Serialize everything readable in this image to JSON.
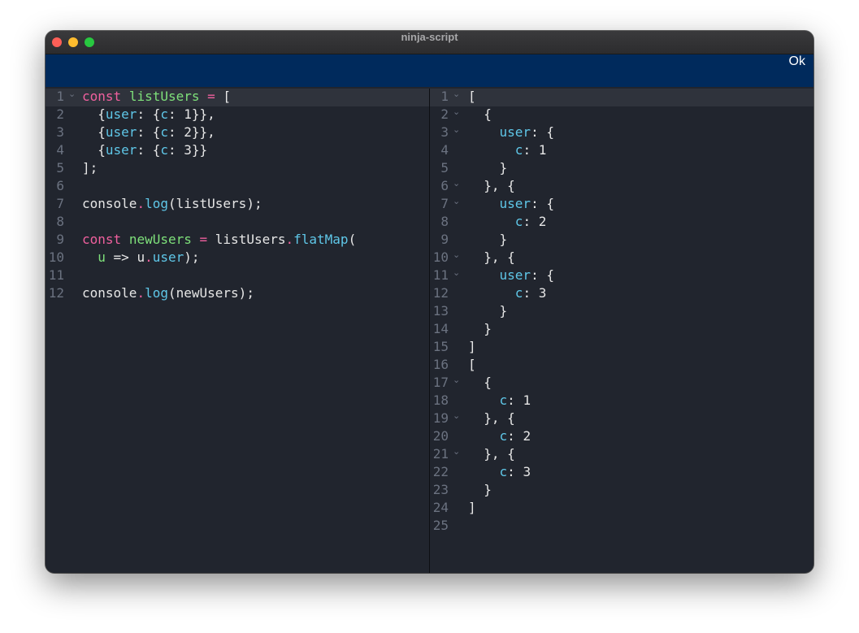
{
  "window": {
    "title": "ninja-script"
  },
  "toolbar": {
    "ok_label": "Ok"
  },
  "editor": {
    "lines": [
      {
        "n": "1",
        "fold": true,
        "tokens": [
          {
            "t": "const",
            "c": "kw"
          },
          {
            "t": " ",
            "c": "txt"
          },
          {
            "t": "listUsers",
            "c": "def"
          },
          {
            "t": " ",
            "c": "txt"
          },
          {
            "t": "=",
            "c": "kw"
          },
          {
            "t": " [",
            "c": "txt"
          }
        ]
      },
      {
        "n": "2",
        "fold": false,
        "tokens": [
          {
            "t": "  {",
            "c": "txt"
          },
          {
            "t": "user",
            "c": "prop"
          },
          {
            "t": ": {",
            "c": "txt"
          },
          {
            "t": "c",
            "c": "prop"
          },
          {
            "t": ": 1}},",
            "c": "txt"
          }
        ]
      },
      {
        "n": "3",
        "fold": false,
        "tokens": [
          {
            "t": "  {",
            "c": "txt"
          },
          {
            "t": "user",
            "c": "prop"
          },
          {
            "t": ": {",
            "c": "txt"
          },
          {
            "t": "c",
            "c": "prop"
          },
          {
            "t": ": 2}},",
            "c": "txt"
          }
        ]
      },
      {
        "n": "4",
        "fold": false,
        "tokens": [
          {
            "t": "  {",
            "c": "txt"
          },
          {
            "t": "user",
            "c": "prop"
          },
          {
            "t": ": {",
            "c": "txt"
          },
          {
            "t": "c",
            "c": "prop"
          },
          {
            "t": ": 3}}",
            "c": "txt"
          }
        ]
      },
      {
        "n": "5",
        "fold": false,
        "tokens": [
          {
            "t": "];",
            "c": "txt"
          }
        ]
      },
      {
        "n": "6",
        "fold": false,
        "tokens": []
      },
      {
        "n": "7",
        "fold": false,
        "tokens": [
          {
            "t": "console",
            "c": "txt"
          },
          {
            "t": ".",
            "c": "pun"
          },
          {
            "t": "log",
            "c": "fn"
          },
          {
            "t": "(listUsers);",
            "c": "txt"
          }
        ]
      },
      {
        "n": "8",
        "fold": false,
        "tokens": []
      },
      {
        "n": "9",
        "fold": false,
        "tokens": [
          {
            "t": "const",
            "c": "kw"
          },
          {
            "t": " ",
            "c": "txt"
          },
          {
            "t": "newUsers",
            "c": "def"
          },
          {
            "t": " ",
            "c": "txt"
          },
          {
            "t": "=",
            "c": "kw"
          },
          {
            "t": " listUsers",
            "c": "txt"
          },
          {
            "t": ".",
            "c": "pun"
          },
          {
            "t": "flatMap",
            "c": "fn"
          },
          {
            "t": "(",
            "c": "txt"
          }
        ]
      },
      {
        "n": "10",
        "fold": false,
        "tokens": [
          {
            "t": "  ",
            "c": "txt"
          },
          {
            "t": "u",
            "c": "def"
          },
          {
            "t": " => u",
            "c": "txt"
          },
          {
            "t": ".",
            "c": "pun"
          },
          {
            "t": "user",
            "c": "prop"
          },
          {
            "t": ");",
            "c": "txt"
          }
        ]
      },
      {
        "n": "11",
        "fold": false,
        "tokens": []
      },
      {
        "n": "12",
        "fold": false,
        "tokens": [
          {
            "t": "console",
            "c": "txt"
          },
          {
            "t": ".",
            "c": "pun"
          },
          {
            "t": "log",
            "c": "fn"
          },
          {
            "t": "(newUsers);",
            "c": "txt"
          }
        ]
      }
    ]
  },
  "output": {
    "lines": [
      {
        "n": "1",
        "fold": true,
        "tokens": [
          {
            "t": "[",
            "c": "txt"
          }
        ]
      },
      {
        "n": "2",
        "fold": true,
        "tokens": [
          {
            "t": "  {",
            "c": "txt"
          }
        ]
      },
      {
        "n": "3",
        "fold": true,
        "tokens": [
          {
            "t": "    ",
            "c": "txt"
          },
          {
            "t": "user",
            "c": "prop"
          },
          {
            "t": ": {",
            "c": "txt"
          }
        ]
      },
      {
        "n": "4",
        "fold": false,
        "tokens": [
          {
            "t": "      ",
            "c": "txt"
          },
          {
            "t": "c",
            "c": "prop"
          },
          {
            "t": ": 1",
            "c": "txt"
          }
        ]
      },
      {
        "n": "5",
        "fold": false,
        "tokens": [
          {
            "t": "    }",
            "c": "txt"
          }
        ]
      },
      {
        "n": "6",
        "fold": true,
        "tokens": [
          {
            "t": "  }, {",
            "c": "txt"
          }
        ]
      },
      {
        "n": "7",
        "fold": true,
        "tokens": [
          {
            "t": "    ",
            "c": "txt"
          },
          {
            "t": "user",
            "c": "prop"
          },
          {
            "t": ": {",
            "c": "txt"
          }
        ]
      },
      {
        "n": "8",
        "fold": false,
        "tokens": [
          {
            "t": "      ",
            "c": "txt"
          },
          {
            "t": "c",
            "c": "prop"
          },
          {
            "t": ": 2",
            "c": "txt"
          }
        ]
      },
      {
        "n": "9",
        "fold": false,
        "tokens": [
          {
            "t": "    }",
            "c": "txt"
          }
        ]
      },
      {
        "n": "10",
        "fold": true,
        "tokens": [
          {
            "t": "  }, {",
            "c": "txt"
          }
        ]
      },
      {
        "n": "11",
        "fold": true,
        "tokens": [
          {
            "t": "    ",
            "c": "txt"
          },
          {
            "t": "user",
            "c": "prop"
          },
          {
            "t": ": {",
            "c": "txt"
          }
        ]
      },
      {
        "n": "12",
        "fold": false,
        "tokens": [
          {
            "t": "      ",
            "c": "txt"
          },
          {
            "t": "c",
            "c": "prop"
          },
          {
            "t": ": 3",
            "c": "txt"
          }
        ]
      },
      {
        "n": "13",
        "fold": false,
        "tokens": [
          {
            "t": "    }",
            "c": "txt"
          }
        ]
      },
      {
        "n": "14",
        "fold": false,
        "tokens": [
          {
            "t": "  }",
            "c": "txt"
          }
        ]
      },
      {
        "n": "15",
        "fold": false,
        "tokens": [
          {
            "t": "]",
            "c": "txt"
          }
        ]
      },
      {
        "n": "16",
        "fold": false,
        "tokens": [
          {
            "t": "[",
            "c": "txt"
          }
        ]
      },
      {
        "n": "17",
        "fold": true,
        "tokens": [
          {
            "t": "  {",
            "c": "txt"
          }
        ]
      },
      {
        "n": "18",
        "fold": false,
        "tokens": [
          {
            "t": "    ",
            "c": "txt"
          },
          {
            "t": "c",
            "c": "prop"
          },
          {
            "t": ": 1",
            "c": "txt"
          }
        ]
      },
      {
        "n": "19",
        "fold": true,
        "tokens": [
          {
            "t": "  }, {",
            "c": "txt"
          }
        ]
      },
      {
        "n": "20",
        "fold": false,
        "tokens": [
          {
            "t": "    ",
            "c": "txt"
          },
          {
            "t": "c",
            "c": "prop"
          },
          {
            "t": ": 2",
            "c": "txt"
          }
        ]
      },
      {
        "n": "21",
        "fold": true,
        "tokens": [
          {
            "t": "  }, {",
            "c": "txt"
          }
        ]
      },
      {
        "n": "22",
        "fold": false,
        "tokens": [
          {
            "t": "    ",
            "c": "txt"
          },
          {
            "t": "c",
            "c": "prop"
          },
          {
            "t": ": 3",
            "c": "txt"
          }
        ]
      },
      {
        "n": "23",
        "fold": false,
        "tokens": [
          {
            "t": "  }",
            "c": "txt"
          }
        ]
      },
      {
        "n": "24",
        "fold": false,
        "tokens": [
          {
            "t": "]",
            "c": "txt"
          }
        ]
      },
      {
        "n": "25",
        "fold": false,
        "tokens": []
      }
    ]
  }
}
